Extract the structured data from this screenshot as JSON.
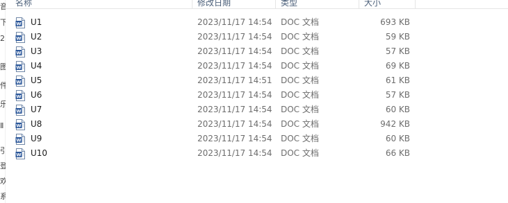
{
  "header": {
    "name": "名称",
    "date": "修改日期",
    "type": "类型",
    "size": "大小"
  },
  "nav_fragments": [
    "音",
    "下",
    "2",
    "图",
    "件",
    "乐",
    "Ⅱ",
    "引",
    "登",
    "欢",
    "系"
  ],
  "files": [
    {
      "name": "U1",
      "date": "2023/11/17 14:54",
      "type": "DOC 文档",
      "size": "693 KB"
    },
    {
      "name": "U2",
      "date": "2023/11/17 14:54",
      "type": "DOC 文档",
      "size": "59 KB"
    },
    {
      "name": "U3",
      "date": "2023/11/17 14:54",
      "type": "DOC 文档",
      "size": "57 KB"
    },
    {
      "name": "U4",
      "date": "2023/11/17 14:54",
      "type": "DOC 文档",
      "size": "69 KB"
    },
    {
      "name": "U5",
      "date": "2023/11/17 14:51",
      "type": "DOC 文档",
      "size": "61 KB"
    },
    {
      "name": "U6",
      "date": "2023/11/17 14:54",
      "type": "DOC 文档",
      "size": "57 KB"
    },
    {
      "name": "U7",
      "date": "2023/11/17 14:54",
      "type": "DOC 文档",
      "size": "60 KB"
    },
    {
      "name": "U8",
      "date": "2023/11/17 14:54",
      "type": "DOC 文档",
      "size": "942 KB"
    },
    {
      "name": "U9",
      "date": "2023/11/17 14:54",
      "type": "DOC 文档",
      "size": "60 KB"
    },
    {
      "name": "U10",
      "date": "2023/11/17 14:54",
      "type": "DOC 文档",
      "size": "66 KB"
    }
  ],
  "icons": {
    "file": "word-document-icon"
  },
  "colors": {
    "header_text": "#4c607a",
    "detail_text": "#6d6d6d",
    "icon_blue": "#2b579a"
  }
}
